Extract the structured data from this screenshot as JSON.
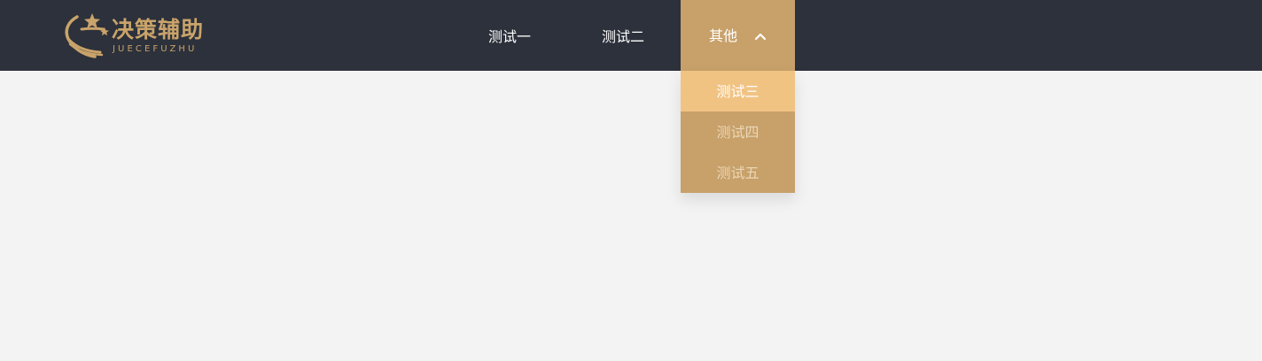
{
  "header": {
    "logo": {
      "title": "决策辅助",
      "subtitle": "JUECEFUZHU",
      "icon": "star-swoosh-icon"
    },
    "nav": {
      "items": [
        {
          "label": "测试一"
        },
        {
          "label": "测试二"
        },
        {
          "label": "其他",
          "icon": "chevron-up-icon"
        }
      ]
    },
    "dropdown": {
      "items": [
        {
          "label": "测试三",
          "state": "active"
        },
        {
          "label": "测试四"
        },
        {
          "label": "测试五"
        }
      ]
    }
  },
  "colors": {
    "header_bg": "#2c313b",
    "page_bg": "#f3f3f3",
    "accent": "#c8a069",
    "active_item": "#f1c383",
    "brand_text": "#c9a36a"
  }
}
